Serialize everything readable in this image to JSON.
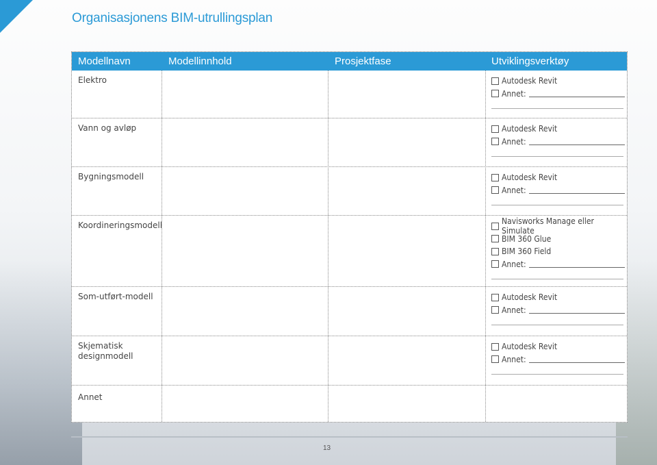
{
  "page": {
    "title": "Organisasjonens BIM-utrullingsplan",
    "page_number": "13"
  },
  "colors": {
    "accent": "#2b9ad6"
  },
  "table": {
    "headers": {
      "model_name": "Modellnavn",
      "model_content": "Modellinnhold",
      "project_phase": "Prosjektfase",
      "dev_tools": "Utviklingsverktøy"
    },
    "rows": [
      {
        "name": "Elektro",
        "options": [
          "Autodesk Revit",
          "Annet:"
        ]
      },
      {
        "name": "Vann og avløp",
        "options": [
          "Autodesk Revit",
          "Annet:"
        ]
      },
      {
        "name": "Bygningsmodell",
        "options": [
          "Autodesk Revit",
          "Annet:"
        ]
      },
      {
        "name": "Koordineringsmodell",
        "options": [
          "Navisworks Manage eller Simulate",
          "BIM 360 Glue",
          "BIM 360 Field",
          "Annet:"
        ]
      },
      {
        "name": "Som-utført-modell",
        "options": [
          "Autodesk Revit",
          "Annet:"
        ]
      },
      {
        "name": "Skjematisk designmodell",
        "name_line1": "Skjematisk",
        "name_line2": "designmodell",
        "options": [
          "Autodesk Revit",
          "Annet:"
        ]
      },
      {
        "name": "Annet",
        "options": []
      }
    ]
  }
}
